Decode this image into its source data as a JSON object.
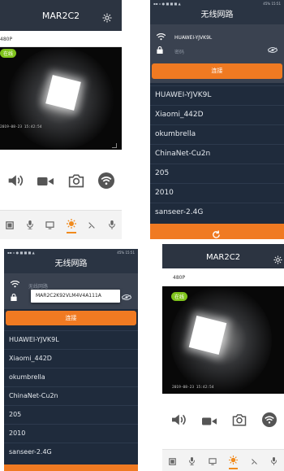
{
  "camera": {
    "title": "MAR2C2",
    "resolution": "480P",
    "online_badge": "在线",
    "timestamp": "2019-08-23 15:42:54",
    "controls": [
      "speaker-icon",
      "record-icon",
      "snapshot-icon",
      "wifi-icon"
    ],
    "bottom_tools": [
      "gallery-icon",
      "microphone-icon",
      "screen-icon",
      "light-icon",
      "zoom-icon",
      "mic-icon"
    ]
  },
  "wifi": {
    "status_left": "▪▪ ▫ ● ■ ■ ■ ▲",
    "status_right": "45% 15:51",
    "title": "无线网路",
    "ssid": "HUAWEI-YJVK9L",
    "ssid_placeholder": "无线网路",
    "password_placeholder": "密码",
    "password_popup": "MAR2C2K92VLM4V4A111A",
    "connect_label": "连接",
    "networks": [
      "HUAWEI-YJVK9L",
      "Xiaomi_442D",
      "okumbrella",
      "ChinaNet-Cu2n",
      "205",
      "2010",
      "sanseer-2.4G"
    ],
    "accent": "#f07a22",
    "background": "#1f2b3c"
  }
}
